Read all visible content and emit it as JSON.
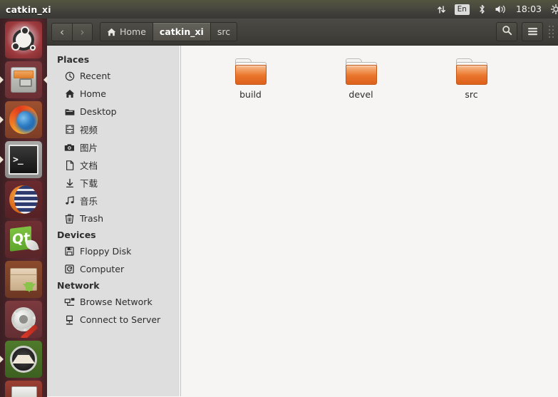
{
  "panel": {
    "app_title": "catkin_xi",
    "tray": {
      "network_icon": "network-updown-icon",
      "keyboard_label": "En",
      "bluetooth_icon": "bluetooth-icon",
      "volume_icon": "volume-icon",
      "clock": "18:03",
      "session_icon": "session-gear-icon"
    }
  },
  "launcher": {
    "items": [
      {
        "name": "ubuntu-dash",
        "label": "Dash Home",
        "running": false
      },
      {
        "name": "files",
        "label": "Files",
        "running": true
      },
      {
        "name": "firefox",
        "label": "Firefox Web Browser",
        "running": false
      },
      {
        "name": "terminal",
        "label": "Terminal",
        "running": true
      },
      {
        "name": "eclipse",
        "label": "Eclipse",
        "running": false
      },
      {
        "name": "qt-creator",
        "label": "Qt Creator",
        "running": false
      },
      {
        "name": "ubuntu-software",
        "label": "Ubuntu Software Center",
        "running": false
      },
      {
        "name": "system-settings",
        "label": "System Settings",
        "running": false
      },
      {
        "name": "gazebo",
        "label": "Gazebo",
        "running": true
      }
    ]
  },
  "toolbar": {
    "back_label": "‹",
    "forward_label": "›",
    "search_icon": "search-icon",
    "menu_icon": "hamburger-menu-icon",
    "breadcrumbs": [
      {
        "label": "Home",
        "icon": "home-icon",
        "active": false
      },
      {
        "label": "catkin_xi",
        "icon": "",
        "active": true
      },
      {
        "label": "src",
        "icon": "",
        "active": false
      }
    ]
  },
  "sidebar": {
    "sections": [
      {
        "header": "Places",
        "items": [
          {
            "label": "Recent",
            "icon": "clock-icon"
          },
          {
            "label": "Home",
            "icon": "home-icon"
          },
          {
            "label": "Desktop",
            "icon": "folder-icon"
          },
          {
            "label": "视频",
            "icon": "video-icon"
          },
          {
            "label": "图片",
            "icon": "camera-icon"
          },
          {
            "label": "文档",
            "icon": "document-icon"
          },
          {
            "label": "下载",
            "icon": "download-icon"
          },
          {
            "label": "音乐",
            "icon": "music-icon"
          },
          {
            "label": "Trash",
            "icon": "trash-icon"
          }
        ]
      },
      {
        "header": "Devices",
        "items": [
          {
            "label": "Floppy Disk",
            "icon": "floppy-icon"
          },
          {
            "label": "Computer",
            "icon": "computer-icon"
          }
        ]
      },
      {
        "header": "Network",
        "items": [
          {
            "label": "Browse Network",
            "icon": "network-browse-icon"
          },
          {
            "label": "Connect to Server",
            "icon": "server-connect-icon"
          }
        ]
      }
    ]
  },
  "content": {
    "files": [
      {
        "name": "build",
        "type": "folder"
      },
      {
        "name": "devel",
        "type": "folder"
      },
      {
        "name": "src",
        "type": "folder"
      }
    ]
  },
  "colors": {
    "panel_bg": "#43423d",
    "launcher_bg": "#51262b",
    "toolbar_bg": "#43423d",
    "sidebar_bg": "#dedede",
    "content_bg": "#f6f5f4",
    "folder_orange": "#e9742b",
    "accent_text": "#ffffff"
  }
}
